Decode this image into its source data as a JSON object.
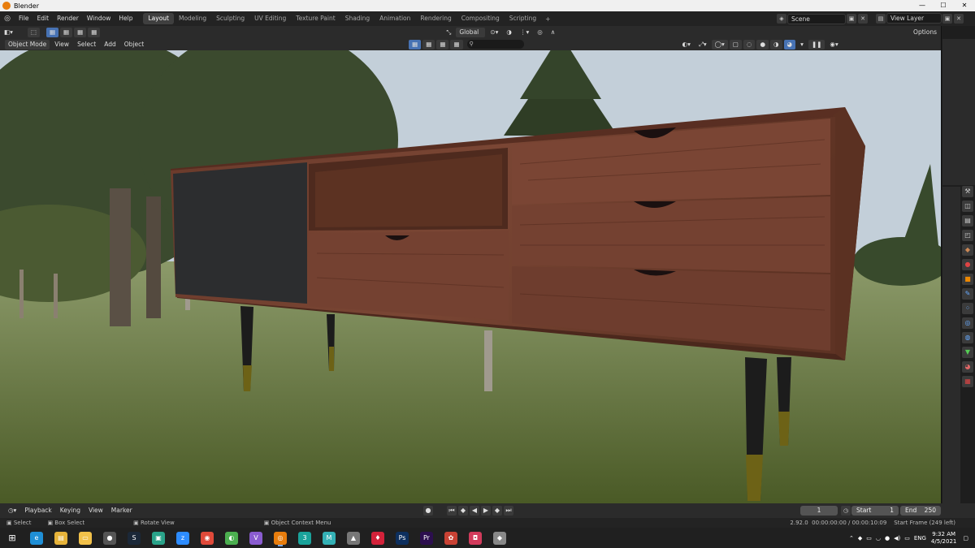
{
  "window": {
    "title": "Blender",
    "controls": [
      "—",
      "☐",
      "✕"
    ]
  },
  "menu": [
    "File",
    "Edit",
    "Render",
    "Window",
    "Help"
  ],
  "workspaces": [
    "Layout",
    "Modeling",
    "Sculpting",
    "UV Editing",
    "Texture Paint",
    "Shading",
    "Animation",
    "Rendering",
    "Compositing",
    "Scripting"
  ],
  "active_workspace": "Layout",
  "scene": {
    "label": "Scene",
    "view_layer": "View Layer"
  },
  "viewport_header": {
    "mode": "Object Mode",
    "menus": [
      "View",
      "Select",
      "Add",
      "Object"
    ],
    "transform_orientation": "Global",
    "options": "Options"
  },
  "timeline": {
    "menus": [
      "Playback",
      "Keying",
      "View",
      "Marker"
    ],
    "current_frame": "1",
    "start_label": "Start",
    "start": "1",
    "end_label": "End",
    "end": "250"
  },
  "statusbar": {
    "select": "Select",
    "box_select": "Box Select",
    "rotate": "Rotate View",
    "context": "Object Context Menu",
    "version": "2.92.0",
    "time": "00:00:00:00 / 00:00:10:09",
    "start_frame": "Start Frame (249 left)"
  },
  "taskbar": {
    "apps": [
      {
        "icon": "edge-icon",
        "glyph": "e",
        "color": "#1f8fd6"
      },
      {
        "icon": "explorer-icon",
        "glyph": "▤",
        "color": "#e6b33a"
      },
      {
        "icon": "files-icon",
        "glyph": "▭",
        "color": "#f2c14a"
      },
      {
        "icon": "obs-icon",
        "glyph": "●",
        "color": "#555"
      },
      {
        "icon": "steam-icon",
        "glyph": "S",
        "color": "#1b2838"
      },
      {
        "icon": "chat-icon",
        "glyph": "▣",
        "color": "#2aa38a"
      },
      {
        "icon": "zoom-icon",
        "glyph": "z",
        "color": "#2d8cff"
      },
      {
        "icon": "chrome-icon",
        "glyph": "◉",
        "color": "#e04a3a"
      },
      {
        "icon": "greenshot-icon",
        "glyph": "◐",
        "color": "#4caf50"
      },
      {
        "icon": "visual-studio-icon",
        "glyph": "V",
        "color": "#8a5cd0"
      },
      {
        "icon": "blender-icon",
        "glyph": "◎",
        "color": "#e87d0d"
      },
      {
        "icon": "3dsmax-icon",
        "glyph": "3",
        "color": "#1aa39b"
      },
      {
        "icon": "maya-icon",
        "glyph": "M",
        "color": "#34b1b6"
      },
      {
        "icon": "marmoset-icon",
        "glyph": "▲",
        "color": "#777"
      },
      {
        "icon": "redapp-icon",
        "glyph": "♦",
        "color": "#d3223a"
      },
      {
        "icon": "photoshop-icon",
        "glyph": "Ps",
        "color": "#0d2f5e"
      },
      {
        "icon": "premiere-icon",
        "glyph": "Pr",
        "color": "#2c0f4e"
      },
      {
        "icon": "paint-icon",
        "glyph": "✿",
        "color": "#c94234"
      },
      {
        "icon": "substance-icon",
        "glyph": "◘",
        "color": "#d23b5c"
      },
      {
        "icon": "misc-icon",
        "glyph": "◆",
        "color": "#888"
      }
    ],
    "lang": "ENG",
    "time": "9:32 AM",
    "date": "4/5/2021"
  },
  "colors": {
    "accent": "#4772b3",
    "wood": "#6b3b2c",
    "door": "#2e2f31"
  }
}
